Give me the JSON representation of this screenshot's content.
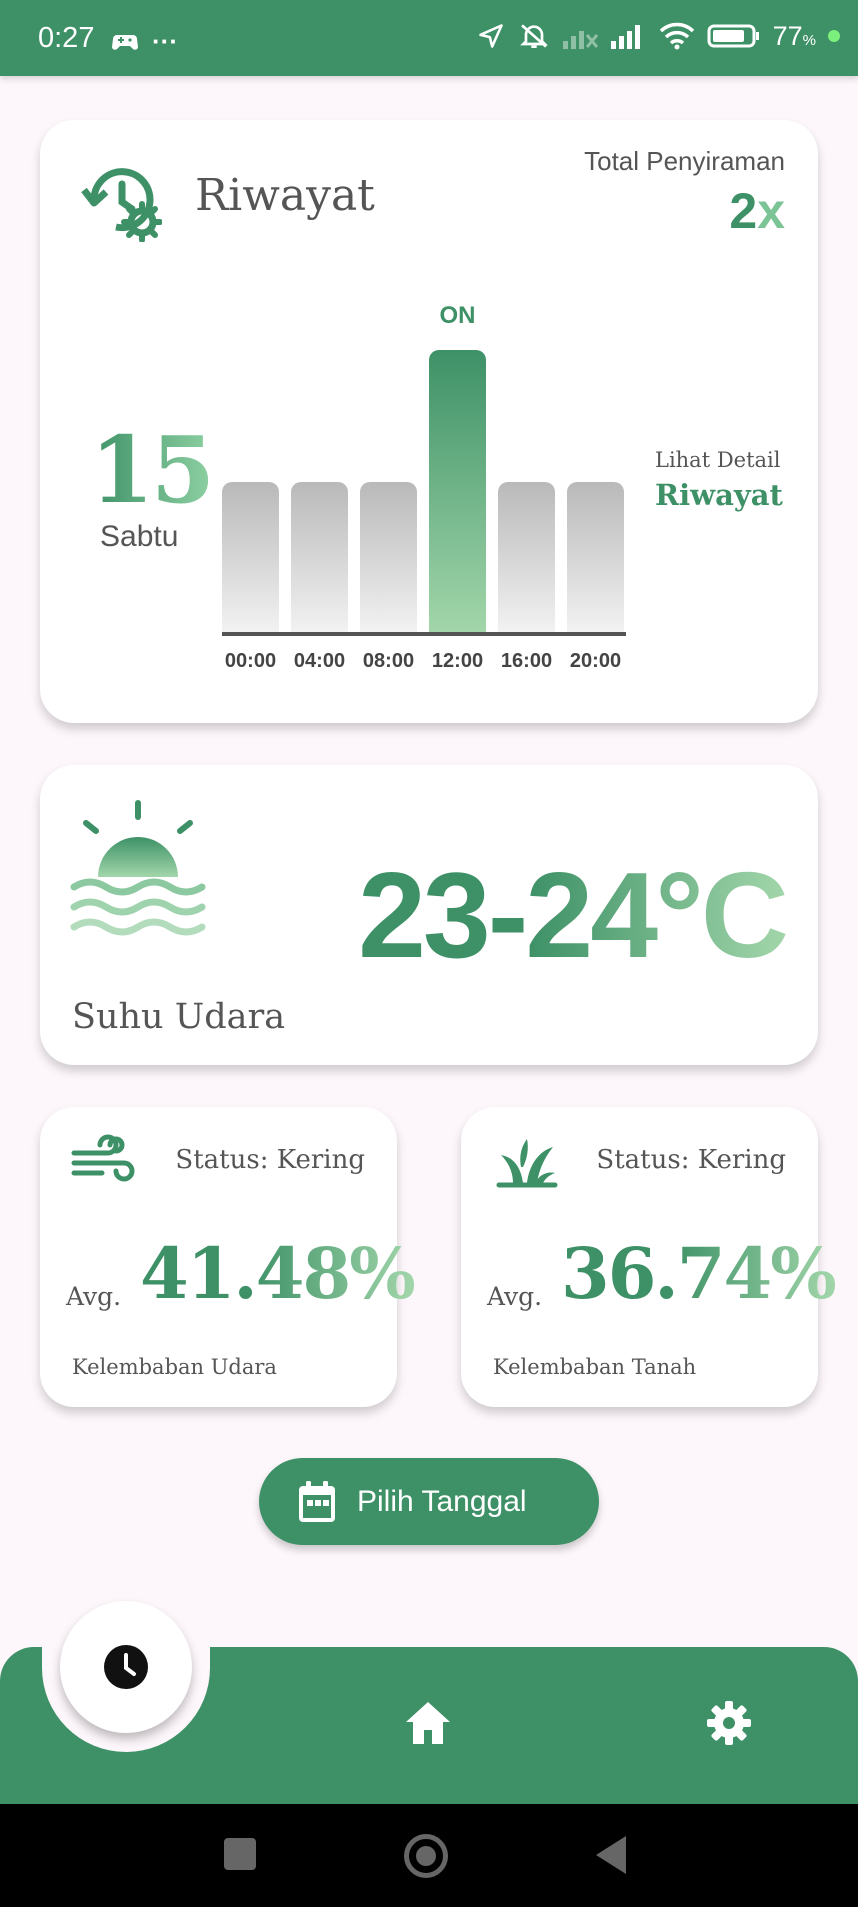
{
  "status_bar": {
    "time": "0:27",
    "more": "···",
    "battery": "77",
    "battery_unit": "%"
  },
  "history_card": {
    "title": "Riwayat",
    "total_label": "Total Penyiraman",
    "total_number": "2",
    "total_suffix": "x",
    "day_number": "15",
    "day_name": "Sabtu",
    "detail_label": "Lihat Detail",
    "detail_link": "Riwayat",
    "on_label": "ON",
    "times": [
      "00:00",
      "04:00",
      "08:00",
      "12:00",
      "16:00",
      "20:00"
    ]
  },
  "temp_card": {
    "value": "23-24°C",
    "label": "Suhu Udara"
  },
  "air_card": {
    "status": "Status: Kering",
    "avg_label": "Avg.",
    "value": "41.48%",
    "label": "Kelembaban Udara"
  },
  "soil_card": {
    "status": "Status: Kering",
    "avg_label": "Avg.",
    "value": "36.74%",
    "label": "Kelembaban Tanah"
  },
  "date_button": {
    "label": "Pilih Tanggal"
  },
  "chart_data": {
    "type": "bar",
    "categories": [
      "00:00",
      "04:00",
      "08:00",
      "12:00",
      "16:00",
      "20:00"
    ],
    "values": [
      0,
      0,
      0,
      1,
      0,
      0
    ],
    "value_labels": [
      "",
      "",
      "",
      "ON",
      "",
      ""
    ],
    "title": "",
    "xlabel": "",
    "ylabel": ""
  },
  "colors": {
    "primary": "#3e9167",
    "accent": "#a2d6aa",
    "background": "#fdf7fb"
  },
  "icons": {
    "history": "history-settings-icon",
    "weather": "sun-waves-icon",
    "wind": "wind-icon",
    "plant": "sprout-icon",
    "calendar": "calendar-icon",
    "clock": "clock-icon",
    "home": "home-icon",
    "settings": "gear-icon"
  }
}
